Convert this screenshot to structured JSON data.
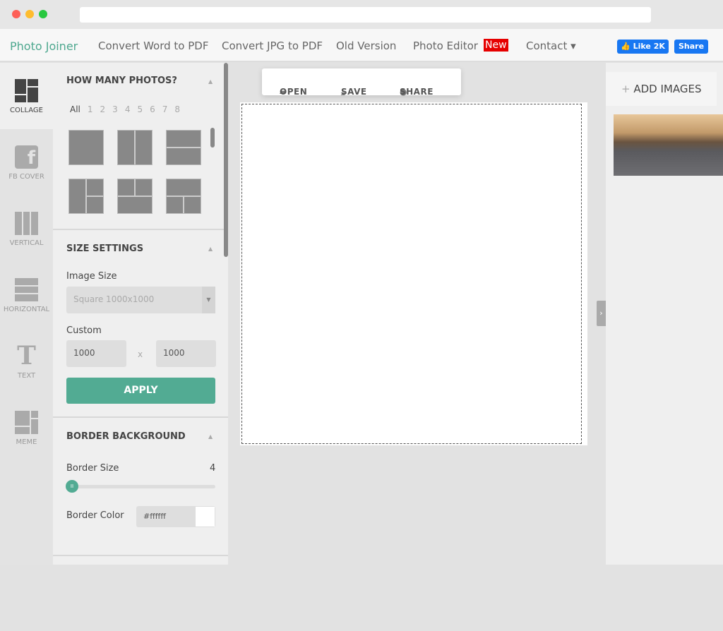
{
  "nav": {
    "brand": "Photo Joiner",
    "links": [
      "Convert Word to PDF",
      "Convert JPG to PDF",
      "Old Version",
      "Photo Editor"
    ],
    "new_badge": "New",
    "contact": "Contact ▾",
    "fb_like": "👍 Like 2K",
    "fb_share": "Share"
  },
  "sidebar": {
    "items": [
      {
        "label": "COLLAGE"
      },
      {
        "label": "FB COVER"
      },
      {
        "label": "VERTICAL"
      },
      {
        "label": "HORIZONTAL"
      },
      {
        "label": "TEXT"
      },
      {
        "label": "MEME"
      }
    ]
  },
  "panel": {
    "photos": {
      "title": "HOW MANY PHOTOS?",
      "counts": [
        "All",
        "1",
        "2",
        "3",
        "4",
        "5",
        "6",
        "7",
        "8"
      ]
    },
    "size": {
      "title": "SIZE SETTINGS",
      "image_size_label": "Image Size",
      "image_size_value": "Square 1000x1000",
      "custom_label": "Custom",
      "width": "1000",
      "x": "x",
      "height": "1000",
      "apply": "APPLY"
    },
    "border": {
      "title": "BORDER BACKGROUND",
      "size_label": "Border Size",
      "size_value": "4",
      "color_label": "Border Color",
      "color_value": "#ffffff"
    }
  },
  "toolbar": {
    "open": "OPEN",
    "save": "SAVE",
    "share": "SHARE"
  },
  "right": {
    "add_images": "ADD IMAGES"
  },
  "colors": {
    "accent": "#52ab93",
    "new_badge": "#e60000",
    "facebook": "#1877f2"
  }
}
